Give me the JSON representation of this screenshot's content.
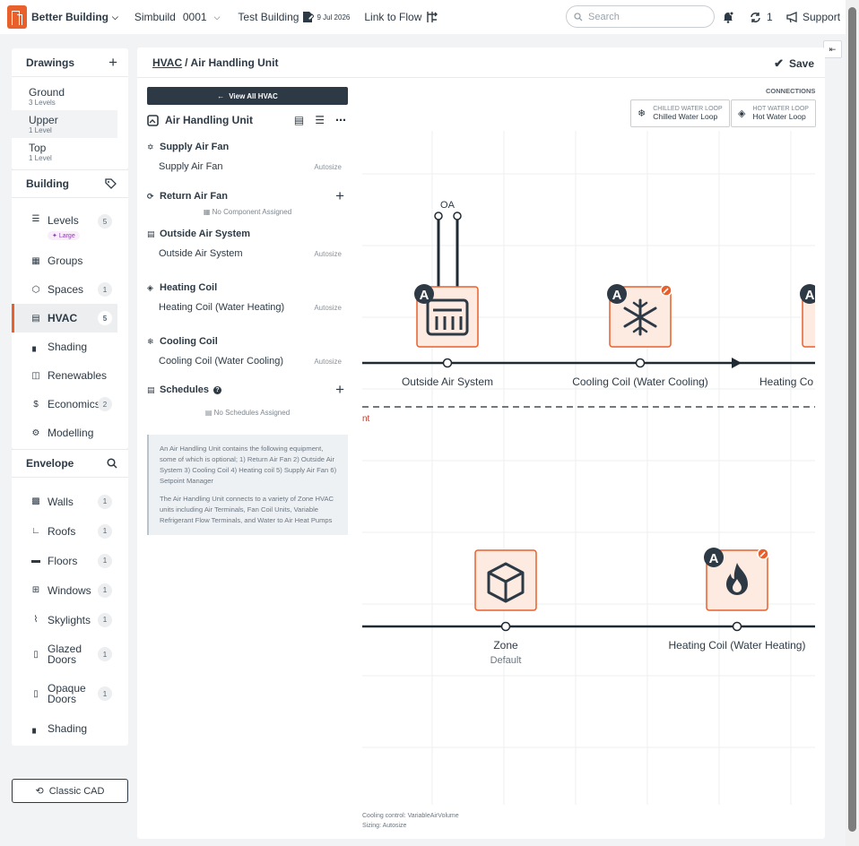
{
  "app": {
    "name": "Better Building",
    "project": "Simbuild",
    "project_number": "0001",
    "building": "Test Building",
    "date": "9 Jul 2026",
    "link_label": "Link to Flow",
    "search_placeholder": "Search",
    "sync_count": "1",
    "support_label": "Support",
    "accent_color": "#e8602c",
    "dark_color": "#2d3a45"
  },
  "sidebar": {
    "drawings": {
      "title": "Drawings",
      "items": [
        {
          "name": "Ground",
          "sub": "3 Levels"
        },
        {
          "name": "Upper",
          "sub": "1 Level"
        },
        {
          "name": "Top",
          "sub": "1 Level"
        }
      ]
    },
    "building": {
      "title": "Building",
      "items": [
        {
          "label": "Levels",
          "badge": "5",
          "tag": "Large",
          "icon": "levels-icon"
        },
        {
          "label": "Groups",
          "badge": "",
          "icon": "groups-icon"
        },
        {
          "label": "Spaces",
          "badge": "1",
          "icon": "cube-icon"
        },
        {
          "label": "HVAC",
          "badge": "5",
          "icon": "hvac-icon"
        },
        {
          "label": "Shading",
          "badge": "",
          "icon": "shading-icon"
        },
        {
          "label": "Renewables",
          "badge": "",
          "icon": "solar-panel-icon"
        },
        {
          "label": "Economics",
          "badge": "2",
          "icon": "dollar-icon"
        },
        {
          "label": "Modelling",
          "badge": "",
          "icon": "gear-icon"
        }
      ]
    },
    "envelope": {
      "title": "Envelope",
      "items": [
        {
          "label": "Walls",
          "badge": "1",
          "icon": "wall-icon"
        },
        {
          "label": "Roofs",
          "badge": "1",
          "icon": "roof-icon"
        },
        {
          "label": "Floors",
          "badge": "1",
          "icon": "floor-icon"
        },
        {
          "label": "Windows",
          "badge": "1",
          "icon": "window-icon"
        },
        {
          "label": "Skylights",
          "badge": "1",
          "icon": "skylight-icon"
        },
        {
          "label": "Glazed Doors",
          "badge": "1",
          "icon": "glazed-door-icon"
        },
        {
          "label": "Opaque Doors",
          "badge": "1",
          "icon": "door-icon"
        },
        {
          "label": "Shading",
          "badge": "",
          "icon": "shading-icon"
        }
      ]
    },
    "classic_cad": "Classic CAD"
  },
  "main": {
    "breadcrumb_parent": "HVAC",
    "breadcrumb_sep": "/",
    "breadcrumb_current": "Air Handling Unit",
    "save_label": "Save",
    "view_all": "View All HVAC",
    "ahu_title": "Air Handling Unit",
    "groups": [
      {
        "title": "Supply Air Fan",
        "item": "Supply Air Fan",
        "size": "Autosize",
        "icon": "fan-icon"
      },
      {
        "title": "Return Air Fan",
        "empty": "No Component Assigned",
        "icon": "return-fan-icon"
      },
      {
        "title": "Outside Air System",
        "item": "Outside Air System",
        "size": "Autosize",
        "icon": "outside-air-icon"
      },
      {
        "title": "Heating Coil",
        "item": "Heating Coil (Water Heating)",
        "size": "Autosize",
        "icon": "flame-icon"
      },
      {
        "title": "Cooling Coil",
        "item": "Cooling Coil (Water Cooling)",
        "size": "Autosize",
        "icon": "snowflake-icon"
      },
      {
        "title": "Schedules",
        "empty": "No Schedules Assigned",
        "icon": "calendar-icon"
      }
    ],
    "info": [
      "An Air Handling Unit contains the following equipment, some of which is optional; 1) Return Air Fan 2) Outside Air System 3) Cooling Coil 4) Heating coil 5) Supply Air Fan 6) Setpoint Manager",
      "The Air Handling Unit connects to a variety of Zone HVAC units including Air Terminals, Fan Coil Units, Variable Refrigerant Flow Terminals, and Water to Air Heat Pumps"
    ],
    "connections": {
      "title": "CONNECTIONS",
      "chilled": {
        "label": "CHILLED WATER LOOP",
        "value": "Chilled Water Loop"
      },
      "hot": {
        "label": "HOT WATER LOOP",
        "value": "Hot Water Loop"
      }
    },
    "diagram": {
      "oa_label": "OA",
      "badge_letter": "A",
      "supply_components": [
        "Outside Air System",
        "Cooling Coil (Water Cooling)",
        "Heating Co"
      ],
      "divider_label": "nt",
      "demand_components": [
        {
          "name": "Zone",
          "sub": "Default"
        },
        {
          "name": "Heating Coil (Water Heating)"
        }
      ]
    },
    "footer": {
      "cooling_control": "Cooling control: VariableAirVolume",
      "sizing": "Sizing: Autosize"
    }
  }
}
